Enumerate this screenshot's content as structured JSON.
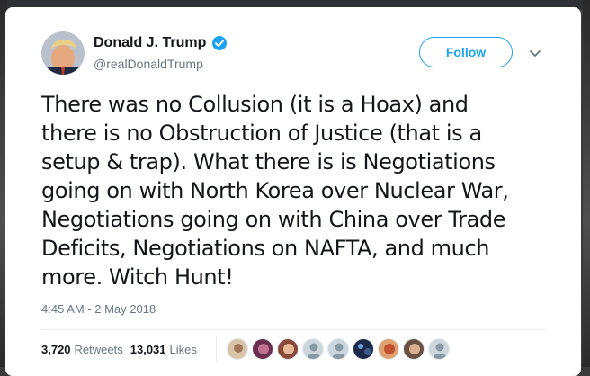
{
  "tweet": {
    "display_name": "Donald J. Trump",
    "handle": "@realDonaldTrump",
    "follow_label": "Follow",
    "text": "There was no Collusion (it is a Hoax) and\nthere is no Obstruction of Justice (that is a\nsetup & trap). What there is is Negotiations\ngoing on with North Korea over Nuclear War,\nNegotiations going on with China over Trade\nDeficits, Negotiations on NAFTA, and much\nmore. Witch Hunt!",
    "timestamp": "4:45 AM - 2 May 2018",
    "retweets_count": "3,720",
    "retweets_label": "Retweets",
    "likes_count": "13,031",
    "likes_label": "Likes"
  },
  "colors": {
    "accent": "#1da1f2",
    "text": "#14171a",
    "muted": "#657786"
  },
  "icons": {
    "verified": "verified-badge-icon",
    "caret": "chevron-down-icon"
  }
}
